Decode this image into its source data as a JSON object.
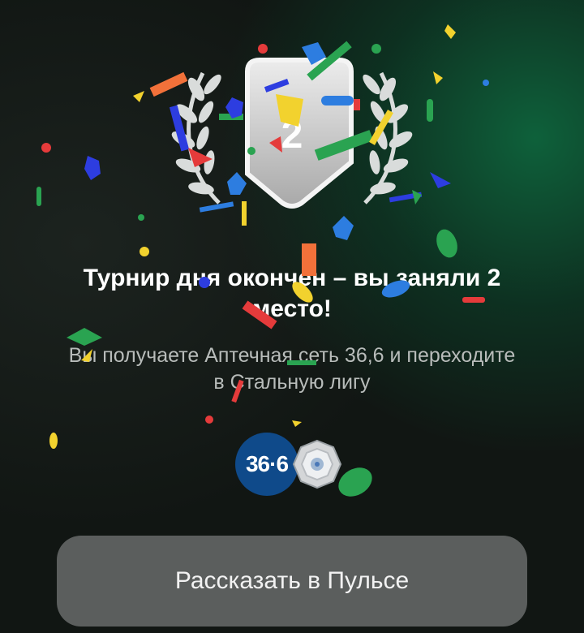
{
  "result": {
    "place_badge": "2",
    "title": "Турнир дня окончен – вы заняли 2 место!",
    "subtitle": "Вы получаете Аптечная сеть 36,6 и переходите в Стальную лигу"
  },
  "rewards": {
    "pharmacy_logo_text": "36·6",
    "league_icon": "steel-league-icon"
  },
  "actions": {
    "share_label": "Рассказать в Пульсе"
  },
  "colors": {
    "accent_green": "#0e6e42",
    "button_bg": "#5b5e5d",
    "pharmacy_blue": "#0f4a8a",
    "badge_silver": "#c9c9c9"
  }
}
